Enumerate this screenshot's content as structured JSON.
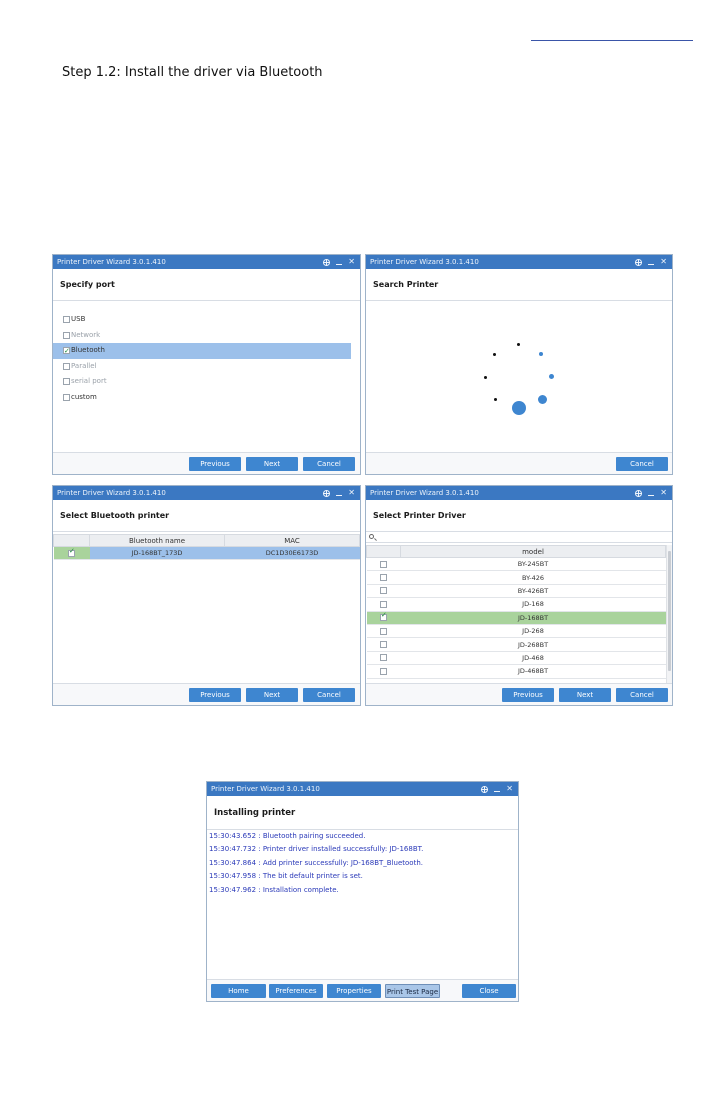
{
  "page": {
    "step_heading": "Step 1.2: Install the driver via Bluetooth"
  },
  "window_title": "Printer Driver Wizard  3.0.1.410",
  "colors": {
    "titlebar": "#3b78c2",
    "button": "#3e86d0",
    "selection": "#9cc0ea",
    "selection_green": "#a9d39c",
    "log_text": "#2a39b8"
  },
  "buttons": {
    "previous": "Previous",
    "next": "Next",
    "cancel": "Cancel",
    "home": "Home",
    "preferences": "Preferences",
    "properties": "Properties",
    "print_test_page": "Print Test Page",
    "close": "Close"
  },
  "specify_port": {
    "heading": "Specify port",
    "ports": [
      {
        "label": "USB",
        "checked": false,
        "enabled": true
      },
      {
        "label": "Network",
        "checked": false,
        "enabled": false
      },
      {
        "label": "Bluetooth",
        "checked": true,
        "enabled": true
      },
      {
        "label": "Parallel",
        "checked": false,
        "enabled": false
      },
      {
        "label": "serial port",
        "checked": false,
        "enabled": false
      },
      {
        "label": "custom",
        "checked": false,
        "enabled": true
      }
    ]
  },
  "search_printer": {
    "heading": "Search Printer"
  },
  "select_bluetooth": {
    "heading": "Select Bluetooth printer",
    "columns": [
      "Bluetooth name",
      "MAC"
    ],
    "rows": [
      {
        "checked": true,
        "name": "JD-168BT_173D",
        "mac": "DC1D30E6173D"
      }
    ]
  },
  "select_driver": {
    "heading": "Select Printer Driver",
    "column": "model",
    "models": [
      {
        "name": "BY-245BT",
        "checked": false
      },
      {
        "name": "BY-426",
        "checked": false
      },
      {
        "name": "BY-426BT",
        "checked": false
      },
      {
        "name": "JD-168",
        "checked": false
      },
      {
        "name": "JD-168BT",
        "checked": true
      },
      {
        "name": "JD-268",
        "checked": false
      },
      {
        "name": "JD-268BT",
        "checked": false
      },
      {
        "name": "JD-468",
        "checked": false
      },
      {
        "name": "JD-468BT",
        "checked": false
      }
    ]
  },
  "installing": {
    "heading": "Installing printer",
    "log": [
      "15:30:43.652 : Bluetooth pairing succeeded.",
      "15:30:47.732 : Printer driver installed successfully: JD-168BT.",
      "15:30:47.864 : Add printer successfully: JD-168BT_Bluetooth.",
      "15:30:47.958 : The bit default printer is set.",
      "15:30:47.962 : Installation complete."
    ]
  }
}
